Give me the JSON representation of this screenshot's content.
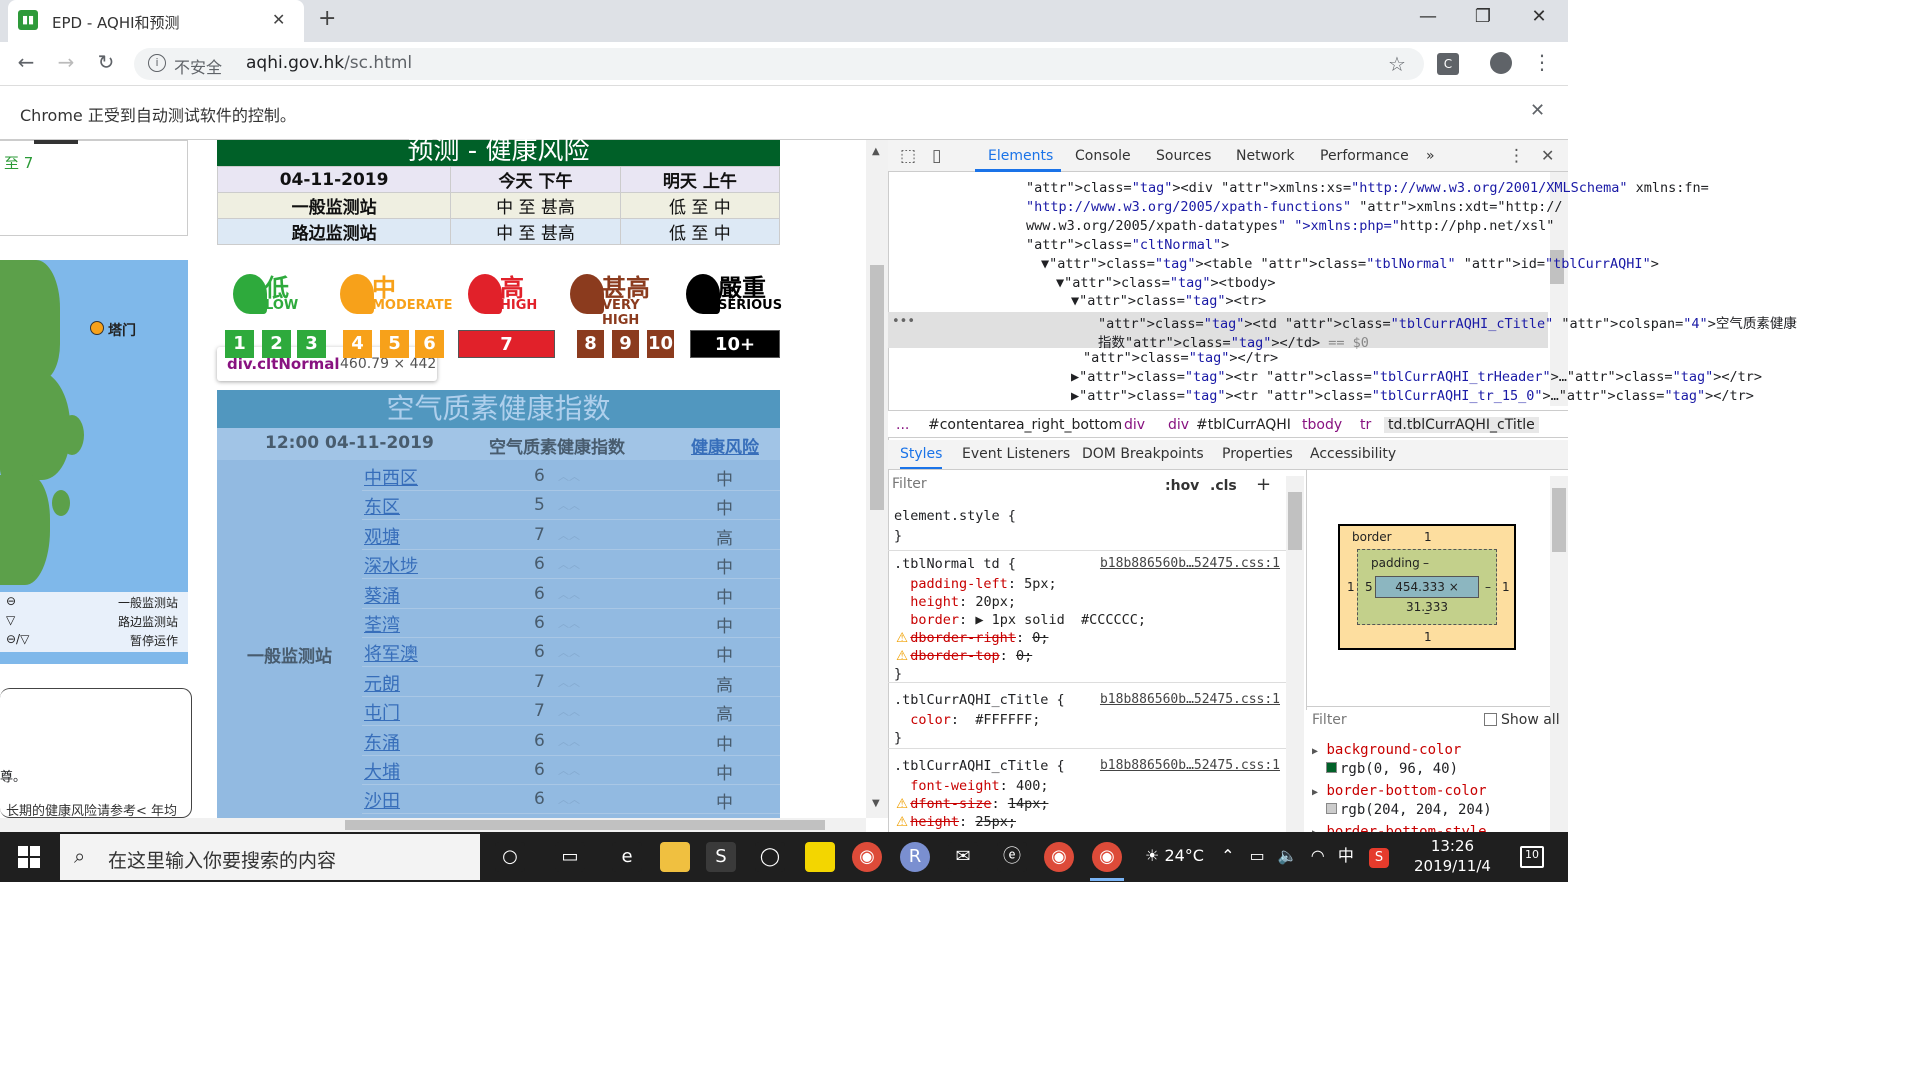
{
  "browser": {
    "tab_title": "EPD - AQHI和预测",
    "favicon": "epd-icon",
    "insecure_label": "不安全",
    "url_host": "aqhi.gov.hk",
    "url_path": "/sc.html",
    "infobar_text": "Chrome 正受到自动测试软件的控制。"
  },
  "page": {
    "left_link": "至 7",
    "map_label": "塔门",
    "legend": [
      {
        "symbol": "⊖",
        "label": "一般监测站"
      },
      {
        "symbol": "▽",
        "label": "路边监测站"
      },
      {
        "symbol": "⊖/▽",
        "label": "暂停运作"
      }
    ],
    "note_text_1": "尊。",
    "note_text_2": "长期的健康风险请参考< 年均",
    "forecast": {
      "title": "预测 - 健康风险",
      "header": [
        "04-11-2019",
        "今天 下午",
        "明天 上午"
      ],
      "rows": [
        {
          "label": "一般监测站",
          "today": "中 至 甚高",
          "tomorrow": "低 至 中"
        },
        {
          "label": "路边监测站",
          "today": "中 至 甚高",
          "tomorrow": "低 至 中"
        }
      ]
    },
    "risk_levels": [
      {
        "zh": "低",
        "en": "LOW",
        "color": "#2eaa3c",
        "nums": [
          "1",
          "2",
          "3"
        ]
      },
      {
        "zh": "中",
        "en": "MODERATE",
        "color": "#f7a11a",
        "nums": [
          "4",
          "5",
          "6"
        ]
      },
      {
        "zh": "高",
        "en": "HIGH",
        "color": "#e1212a",
        "nums": [
          "7"
        ]
      },
      {
        "zh": "甚高",
        "en": "VERY HIGH",
        "color": "#8b3b1e",
        "nums": [
          "8",
          "9",
          "10"
        ]
      },
      {
        "zh": "嚴重",
        "en": "SERIOUS",
        "color": "#000000",
        "nums": [
          "10+"
        ]
      }
    ],
    "tooltip": {
      "name": "div.cltNormal",
      "size": "460.79 × 442"
    },
    "aqhi": {
      "title": "空气质素健康指数",
      "time": "12:00 04-11-2019",
      "col_index": "空气质素健康指数",
      "col_risk": "健康风险",
      "station_type": "一般监测站",
      "rows": [
        {
          "district": "中西区",
          "index": "6",
          "risk": "中"
        },
        {
          "district": "东区",
          "index": "5",
          "risk": "中"
        },
        {
          "district": "观塘",
          "index": "7",
          "risk": "高"
        },
        {
          "district": "深水埗",
          "index": "6",
          "risk": "中"
        },
        {
          "district": "葵涌",
          "index": "6",
          "risk": "中"
        },
        {
          "district": "荃湾",
          "index": "6",
          "risk": "中"
        },
        {
          "district": "将军澳",
          "index": "6",
          "risk": "中"
        },
        {
          "district": "元朗",
          "index": "7",
          "risk": "高"
        },
        {
          "district": "屯门",
          "index": "7",
          "risk": "高"
        },
        {
          "district": "东涌",
          "index": "6",
          "risk": "中"
        },
        {
          "district": "大埔",
          "index": "6",
          "risk": "中"
        },
        {
          "district": "沙田",
          "index": "6",
          "risk": "中"
        }
      ]
    }
  },
  "devtools": {
    "tabs": [
      "Elements",
      "Console",
      "Sources",
      "Network",
      "Performance",
      "»"
    ],
    "code_lines": [
      {
        "indent": "",
        "text": "<div xmlns:xs=\"http://www.w3.org/2001/XMLSchema\" xmlns:fn="
      },
      {
        "indent": "",
        "text": "\"http://www.w3.org/2005/xpath-functions\" xmlns:xdt=\"http://"
      },
      {
        "indent": "",
        "text": "www.w3.org/2005/xpath-datatypes\" xmlns:php=\"http://php.net/xsl\""
      },
      {
        "indent": "",
        "text": "class=\"cltNormal\">"
      },
      {
        "indent": "",
        "text": "▼<table class=\"tblNormal\" id=\"tblCurrAQHI\">"
      },
      {
        "indent": "",
        "text": "▼<tbody>"
      },
      {
        "indent": "",
        "text": "▼<tr>"
      },
      {
        "indent": "",
        "text": "<td class=\"tblCurrAQHI_cTitle\" colspan=\"4\">空气质素健康"
      },
      {
        "indent": "",
        "text": "指数</td> == $0"
      },
      {
        "indent": "",
        "text": "</tr>"
      },
      {
        "indent": "",
        "text": "▶<tr class=\"tblCurrAQHI_trHeader\">…</tr>"
      },
      {
        "indent": "",
        "text": "▶<tr class=\"tblCurrAQHI_tr_15_0\">…</tr>"
      }
    ],
    "breadcrumbs": [
      "...",
      "#contentarea_right_bottom",
      "div",
      "div",
      "#tblCurrAQHI",
      "tbody",
      "tr",
      "td.tblCurrAQHI_cTitle"
    ],
    "subtabs": [
      "Styles",
      "Event Listeners",
      "DOM Breakpoints",
      "Properties",
      "Accessibility"
    ],
    "filter_placeholder": "Filter",
    "hov": ":hov",
    "cls": ".cls",
    "styles": [
      "element.style {",
      "}",
      ".tblNormal td {",
      "  padding-left: 5px;",
      "  height: 20px;",
      "  border: ▶ 1px solid  #CCCCCC;",
      "  dborder-right: 0;",
      "  dborder-top: 0;",
      "}",
      ".tblCurrAQHI_cTitle {",
      "  color:  #FFFFFF;",
      "}",
      ".tblCurrAQHI_cTitle {",
      "  font-weight: 400;",
      "  dfont-size: 14px;",
      "  height: 25px;"
    ],
    "style_source": "b18b886560b…52475.css:1",
    "boxmodel": {
      "border": "1",
      "padding": "–",
      "content": "454.333 × 31.333",
      "left": "1",
      "pad_left": "5"
    },
    "computed_filter": "Filter",
    "show_all": "Show all",
    "computed": [
      {
        "prop": "background-color",
        "value": "rgb(0, 96, 40)"
      },
      {
        "prop": "border-bottom-color",
        "value": "rgb(204, 204, 204)"
      },
      {
        "prop": "border-bottom-style",
        "value": ""
      }
    ]
  },
  "taskbar": {
    "search_placeholder": "在这里输入你要搜索的内容",
    "weather": "24°C",
    "ime": "中",
    "time": "13:26",
    "date": "2019/11/4",
    "notif_count": "10"
  }
}
